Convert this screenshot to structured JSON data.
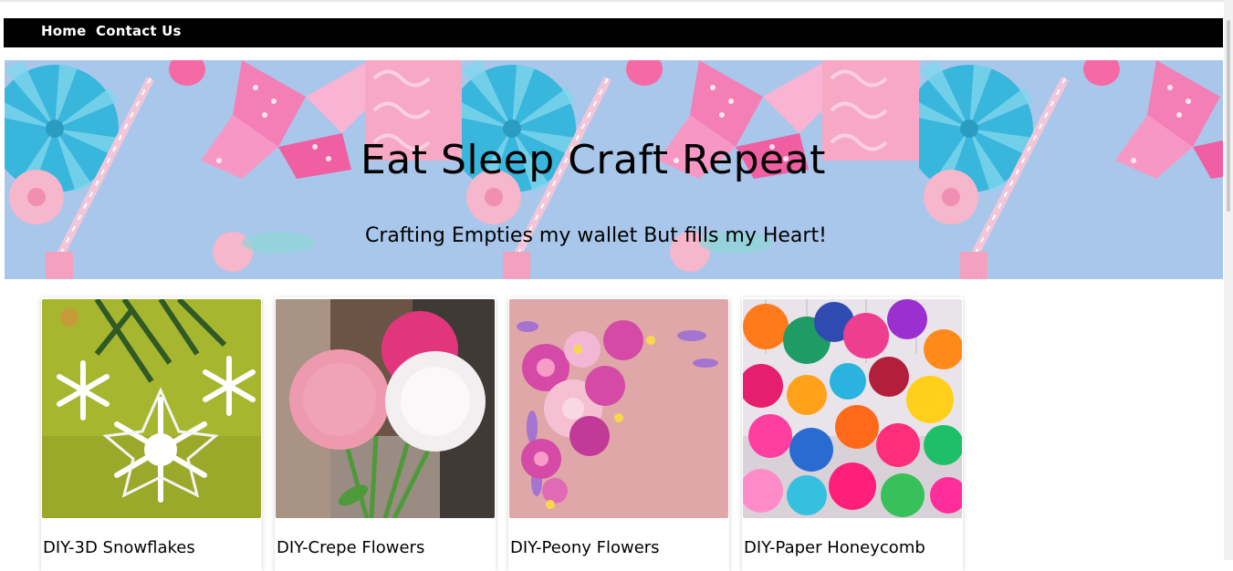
{
  "nav": {
    "home_label": "Home",
    "contact_label": "Contact Us"
  },
  "hero": {
    "title": "Eat Sleep Craft Repeat",
    "tagline": "Crafting Empties my wallet But fills my Heart!"
  },
  "cards": [
    {
      "title": "DIY-3D Snowflakes",
      "image": "paper-snowflakes-image"
    },
    {
      "title": "DIY-Crepe Flowers",
      "image": "crepe-paper-flowers-image"
    },
    {
      "title": "DIY-Peony Flowers",
      "image": "paper-peony-flowers-image"
    },
    {
      "title": "DIY-Paper Honeycomb",
      "image": "honeycomb-balls-image"
    }
  ],
  "colors": {
    "navbar": "#000000",
    "hero_sky": "#a8c6ea",
    "paper_blue": "#39b7dc",
    "paper_pink": "#f06aa6"
  }
}
